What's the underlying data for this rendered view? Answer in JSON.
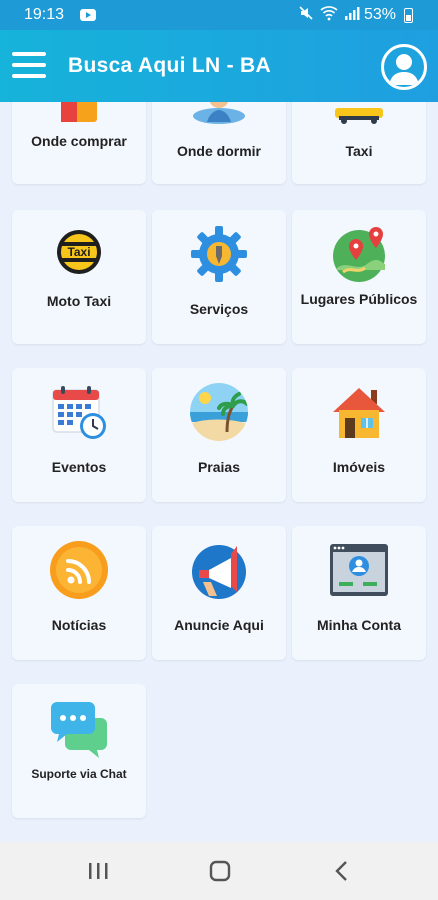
{
  "status_bar": {
    "time": "19:13",
    "battery": "53%",
    "icons": [
      "youtube-icon",
      "mute-icon",
      "wifi-icon",
      "signal-icon",
      "battery-icon"
    ]
  },
  "app_bar": {
    "title": "Busca Aqui LN - BA",
    "menu_icon": "hamburger-icon",
    "account_icon": "user-avatar-icon"
  },
  "tiles": [
    {
      "label": "Onde comprar",
      "icon": "shopping-bag-icon"
    },
    {
      "label": "Onde dormir",
      "icon": "sleeping-person-icon"
    },
    {
      "label": "Taxi",
      "icon": "taxi-car-icon"
    },
    {
      "label": "Moto Taxi",
      "icon": "taxi-sign-icon"
    },
    {
      "label": "Serviços",
      "icon": "gear-wrench-icon"
    },
    {
      "label": "Lugares Públicos",
      "icon": "map-pins-icon"
    },
    {
      "label": "Eventos",
      "icon": "calendar-clock-icon"
    },
    {
      "label": "Praias",
      "icon": "beach-palm-icon"
    },
    {
      "label": "Imóveis",
      "icon": "house-icon"
    },
    {
      "label": "Notícias",
      "icon": "rss-feed-icon"
    },
    {
      "label": "Anuncie Aqui",
      "icon": "megaphone-icon"
    },
    {
      "label": "Minha Conta",
      "icon": "profile-window-icon"
    },
    {
      "label": "Suporte via Chat",
      "icon": "chat-bubbles-icon"
    }
  ],
  "nav_bar": {
    "buttons": [
      "recent-apps-icon",
      "home-icon",
      "back-icon"
    ]
  },
  "colors": {
    "app_bar": "#1e9fe0",
    "background": "#eaf1fd",
    "card": "#f3f8fe"
  }
}
